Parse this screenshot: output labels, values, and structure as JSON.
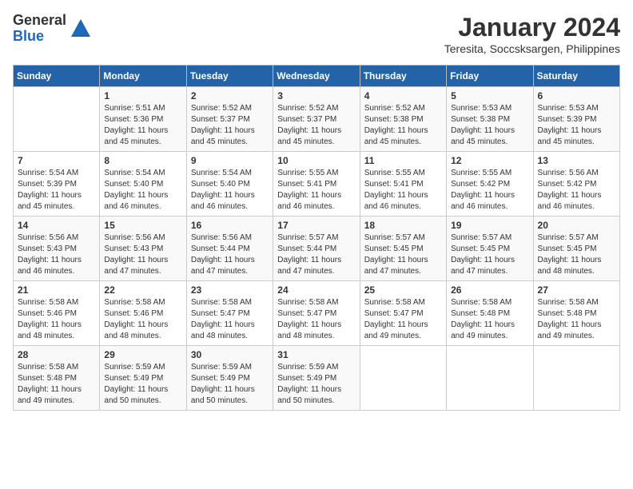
{
  "header": {
    "logo_general": "General",
    "logo_blue": "Blue",
    "month_year": "January 2024",
    "location": "Teresita, Soccsksargen, Philippines"
  },
  "days_of_week": [
    "Sunday",
    "Monday",
    "Tuesday",
    "Wednesday",
    "Thursday",
    "Friday",
    "Saturday"
  ],
  "weeks": [
    [
      {
        "day": "",
        "info": ""
      },
      {
        "day": "1",
        "info": "Sunrise: 5:51 AM\nSunset: 5:36 PM\nDaylight: 11 hours\nand 45 minutes."
      },
      {
        "day": "2",
        "info": "Sunrise: 5:52 AM\nSunset: 5:37 PM\nDaylight: 11 hours\nand 45 minutes."
      },
      {
        "day": "3",
        "info": "Sunrise: 5:52 AM\nSunset: 5:37 PM\nDaylight: 11 hours\nand 45 minutes."
      },
      {
        "day": "4",
        "info": "Sunrise: 5:52 AM\nSunset: 5:38 PM\nDaylight: 11 hours\nand 45 minutes."
      },
      {
        "day": "5",
        "info": "Sunrise: 5:53 AM\nSunset: 5:38 PM\nDaylight: 11 hours\nand 45 minutes."
      },
      {
        "day": "6",
        "info": "Sunrise: 5:53 AM\nSunset: 5:39 PM\nDaylight: 11 hours\nand 45 minutes."
      }
    ],
    [
      {
        "day": "7",
        "info": "Sunrise: 5:54 AM\nSunset: 5:39 PM\nDaylight: 11 hours\nand 45 minutes."
      },
      {
        "day": "8",
        "info": "Sunrise: 5:54 AM\nSunset: 5:40 PM\nDaylight: 11 hours\nand 46 minutes."
      },
      {
        "day": "9",
        "info": "Sunrise: 5:54 AM\nSunset: 5:40 PM\nDaylight: 11 hours\nand 46 minutes."
      },
      {
        "day": "10",
        "info": "Sunrise: 5:55 AM\nSunset: 5:41 PM\nDaylight: 11 hours\nand 46 minutes."
      },
      {
        "day": "11",
        "info": "Sunrise: 5:55 AM\nSunset: 5:41 PM\nDaylight: 11 hours\nand 46 minutes."
      },
      {
        "day": "12",
        "info": "Sunrise: 5:55 AM\nSunset: 5:42 PM\nDaylight: 11 hours\nand 46 minutes."
      },
      {
        "day": "13",
        "info": "Sunrise: 5:56 AM\nSunset: 5:42 PM\nDaylight: 11 hours\nand 46 minutes."
      }
    ],
    [
      {
        "day": "14",
        "info": "Sunrise: 5:56 AM\nSunset: 5:43 PM\nDaylight: 11 hours\nand 46 minutes."
      },
      {
        "day": "15",
        "info": "Sunrise: 5:56 AM\nSunset: 5:43 PM\nDaylight: 11 hours\nand 47 minutes."
      },
      {
        "day": "16",
        "info": "Sunrise: 5:56 AM\nSunset: 5:44 PM\nDaylight: 11 hours\nand 47 minutes."
      },
      {
        "day": "17",
        "info": "Sunrise: 5:57 AM\nSunset: 5:44 PM\nDaylight: 11 hours\nand 47 minutes."
      },
      {
        "day": "18",
        "info": "Sunrise: 5:57 AM\nSunset: 5:45 PM\nDaylight: 11 hours\nand 47 minutes."
      },
      {
        "day": "19",
        "info": "Sunrise: 5:57 AM\nSunset: 5:45 PM\nDaylight: 11 hours\nand 47 minutes."
      },
      {
        "day": "20",
        "info": "Sunrise: 5:57 AM\nSunset: 5:45 PM\nDaylight: 11 hours\nand 48 minutes."
      }
    ],
    [
      {
        "day": "21",
        "info": "Sunrise: 5:58 AM\nSunset: 5:46 PM\nDaylight: 11 hours\nand 48 minutes."
      },
      {
        "day": "22",
        "info": "Sunrise: 5:58 AM\nSunset: 5:46 PM\nDaylight: 11 hours\nand 48 minutes."
      },
      {
        "day": "23",
        "info": "Sunrise: 5:58 AM\nSunset: 5:47 PM\nDaylight: 11 hours\nand 48 minutes."
      },
      {
        "day": "24",
        "info": "Sunrise: 5:58 AM\nSunset: 5:47 PM\nDaylight: 11 hours\nand 48 minutes."
      },
      {
        "day": "25",
        "info": "Sunrise: 5:58 AM\nSunset: 5:47 PM\nDaylight: 11 hours\nand 49 minutes."
      },
      {
        "day": "26",
        "info": "Sunrise: 5:58 AM\nSunset: 5:48 PM\nDaylight: 11 hours\nand 49 minutes."
      },
      {
        "day": "27",
        "info": "Sunrise: 5:58 AM\nSunset: 5:48 PM\nDaylight: 11 hours\nand 49 minutes."
      }
    ],
    [
      {
        "day": "28",
        "info": "Sunrise: 5:58 AM\nSunset: 5:48 PM\nDaylight: 11 hours\nand 49 minutes."
      },
      {
        "day": "29",
        "info": "Sunrise: 5:59 AM\nSunset: 5:49 PM\nDaylight: 11 hours\nand 50 minutes."
      },
      {
        "day": "30",
        "info": "Sunrise: 5:59 AM\nSunset: 5:49 PM\nDaylight: 11 hours\nand 50 minutes."
      },
      {
        "day": "31",
        "info": "Sunrise: 5:59 AM\nSunset: 5:49 PM\nDaylight: 11 hours\nand 50 minutes."
      },
      {
        "day": "",
        "info": ""
      },
      {
        "day": "",
        "info": ""
      },
      {
        "day": "",
        "info": ""
      }
    ]
  ]
}
